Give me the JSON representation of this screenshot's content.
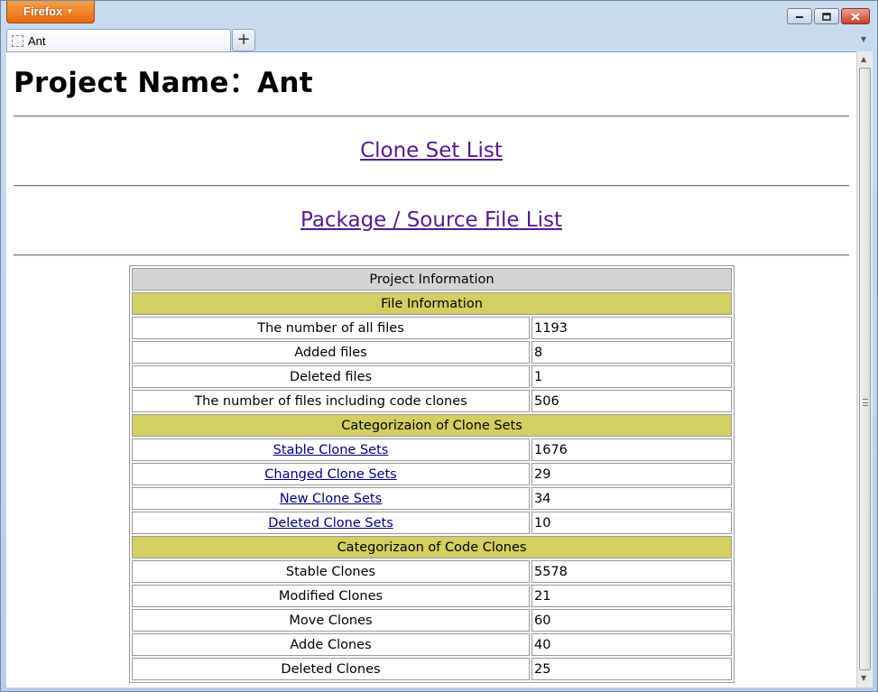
{
  "browser": {
    "app_button": "Firefox",
    "tab_title": "Ant",
    "new_tab_symbol": "+"
  },
  "page": {
    "title": "Project Name：Ant",
    "links": {
      "clone_set_list": "Clone Set List",
      "package_source_file_list": "Package / Source File List"
    }
  },
  "table": {
    "header": "Project Information",
    "sections": [
      {
        "title": "File Information",
        "rows": [
          {
            "label": "The number of all files",
            "value": "1193",
            "link": false
          },
          {
            "label": "Added files",
            "value": "8",
            "link": false
          },
          {
            "label": "Deleted files",
            "value": "1",
            "link": false
          },
          {
            "label": "The number of files including code clones",
            "value": "506",
            "link": false
          }
        ]
      },
      {
        "title": "Categorizaion of Clone Sets",
        "rows": [
          {
            "label": "Stable Clone Sets",
            "value": "1676",
            "link": true
          },
          {
            "label": "Changed Clone Sets",
            "value": "29",
            "link": true
          },
          {
            "label": "New Clone Sets",
            "value": "34",
            "link": true
          },
          {
            "label": "Deleted Clone Sets",
            "value": "10",
            "link": true
          }
        ]
      },
      {
        "title": "Categorizaon of Code Clones",
        "rows": [
          {
            "label": "Stable Clones",
            "value": "5578",
            "link": false
          },
          {
            "label": "Modified Clones",
            "value": "21",
            "link": false
          },
          {
            "label": "Move Clones",
            "value": "60",
            "link": false
          },
          {
            "label": "Adde Clones",
            "value": "40",
            "link": false
          },
          {
            "label": "Deleted Clones",
            "value": "25",
            "link": false
          }
        ]
      }
    ]
  },
  "colors": {
    "section_bg": "#d3cf62",
    "header_bg": "#d4d4d4",
    "visited_link": "#551a8b",
    "link": "#00007f"
  }
}
